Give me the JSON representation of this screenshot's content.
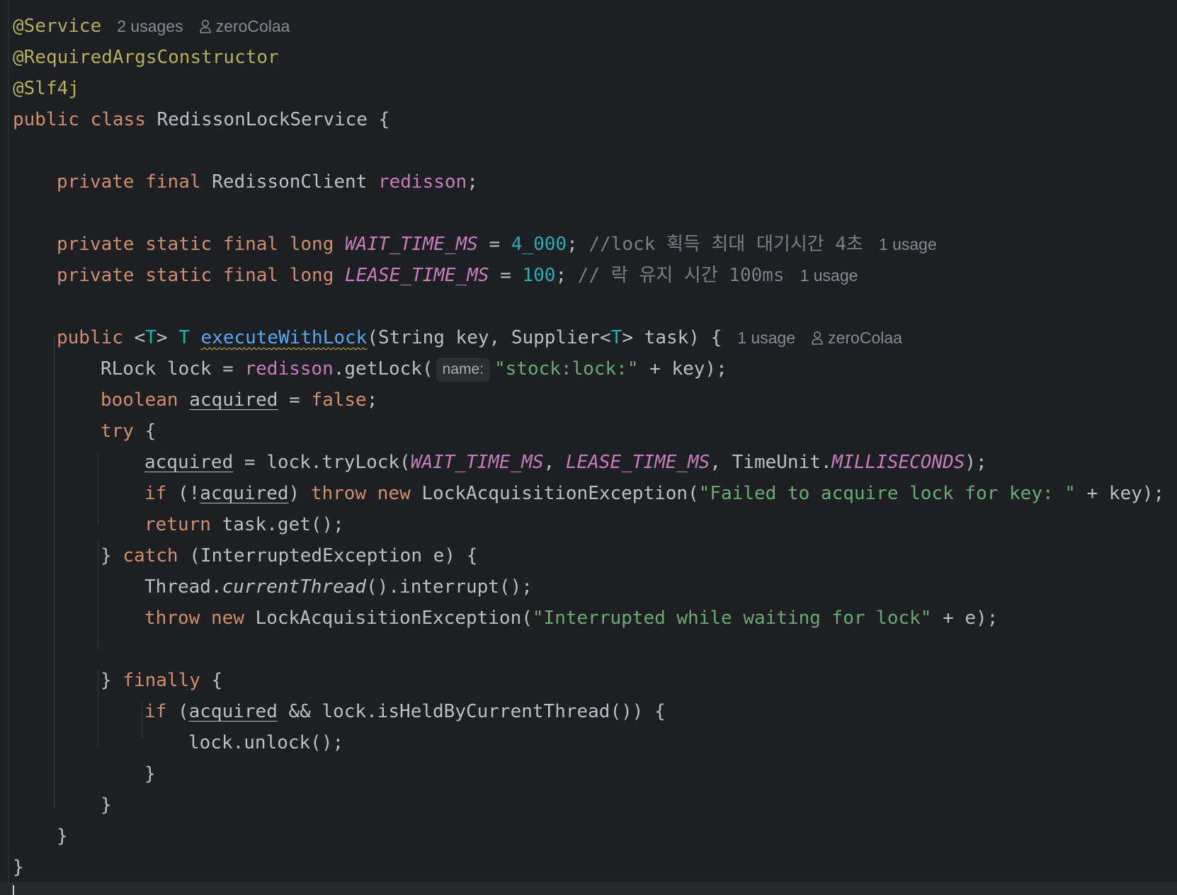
{
  "editor": {
    "inlay": {
      "usages_2": "2 usages",
      "usage_1": "1 usage",
      "author": "zeroColaa",
      "param_name": "name:"
    },
    "code": {
      "ann_service": "@Service",
      "ann_required": "@RequiredArgsConstructor",
      "ann_slf4j": "@Slf4j",
      "kw_public": "public",
      "kw_class": "class",
      "class_name": " RedissonLockService {",
      "kw_private": "private",
      "kw_final": "final",
      "kw_static": "static",
      "kw_long": "long",
      "redisson_client": " RedissonClient ",
      "field_redisson": "redisson",
      "semicolon": ";",
      "const_wait": "WAIT_TIME_MS",
      "const_lease": "LEASE_TIME_MS",
      "eq": " = ",
      "num_wait": "4_000",
      "num_lease": "100",
      "cmt_wait": "//lock 획득 최대 대기시간 4초",
      "cmt_lease": "// 락 유지 시간 100ms",
      "generic_open": " <",
      "tparam": "T",
      "generic_close": "> ",
      "method_name": "executeWithLock",
      "method_params_1": "(String key, Supplier<",
      "method_params_2": "> task) {",
      "rlock_decl": "RLock lock = ",
      "get_lock": ".getLock(",
      "str_lockkey": "\"stock:lock:\"",
      "plus_key_end": " + key);",
      "kw_boolean": "boolean",
      "var_acquired": "acquired",
      "kw_false": "false",
      "kw_try": "try",
      "brace_open": " {",
      "try_lock_call": " = lock.tryLock(",
      "comma": ", ",
      "timeunit": "TimeUnit.",
      "const_millis": "MILLISECONDS",
      "paren_semi": ");",
      "kw_if": "if",
      "if_not_open": " (!",
      "paren_close": ") ",
      "kw_throw": "throw",
      "kw_new": "new",
      "lock_exc_open": " LockAcquisitionException(",
      "str_failed": "\"Failed to acquire lock for key: \"",
      "kw_return": "return",
      "task_get": " task.get();",
      "close_brace_sp": "} ",
      "kw_catch": "catch",
      "catch_params": " (InterruptedException e) {",
      "thread_prefix": "Thread.",
      "current_thread": "currentThread",
      "interrupt_call": "().interrupt();",
      "str_interrupted": "\"Interrupted while waiting for lock\"",
      "plus_e_end": " + e);",
      "kw_finally": "finally",
      "if_open": " (",
      "held_check": " && lock.isHeldByCurrentThread()) {",
      "unlock_call": "lock.unlock();",
      "close_brace": "}"
    }
  }
}
